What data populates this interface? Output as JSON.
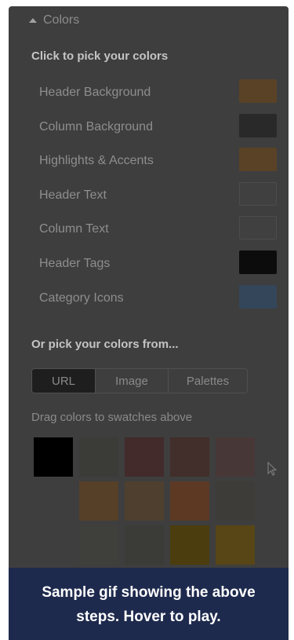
{
  "section": {
    "toggle_label": "Colors"
  },
  "picker_title": "Click to pick your colors",
  "color_rows": [
    {
      "label": "Header Background",
      "color": "#5a4226"
    },
    {
      "label": "Column Background",
      "color": "#292929"
    },
    {
      "label": "Highlights & Accents",
      "color": "#5a4226"
    },
    {
      "label": "Header Text",
      "color": "#404040",
      "outlined": true
    },
    {
      "label": "Column Text",
      "color": "#404040",
      "outlined": true
    },
    {
      "label": "Header Tags",
      "color": "#0c0c0c"
    },
    {
      "label": "Category Icons",
      "color": "#34465a"
    }
  ],
  "source_title": "Or pick your colors from...",
  "source_tabs": [
    {
      "label": "URL",
      "active": true
    },
    {
      "label": "Image",
      "active": false
    },
    {
      "label": "Palettes",
      "active": false
    }
  ],
  "drag_hint": "Drag colors to swatches above",
  "palette_rows": [
    [
      "#000000",
      "#3b3b38",
      "#432b2b",
      "#422e2a",
      "#483737"
    ],
    [
      "#574028",
      "#4f3f2e",
      "#5d3924",
      "#3e3c38"
    ],
    [
      "#3f3f3b",
      "#3b3c37",
      "#4b3d0d",
      "#584616"
    ]
  ],
  "banner": {
    "line1": "Sample gif showing the above",
    "line2": "steps. Hover to play."
  }
}
